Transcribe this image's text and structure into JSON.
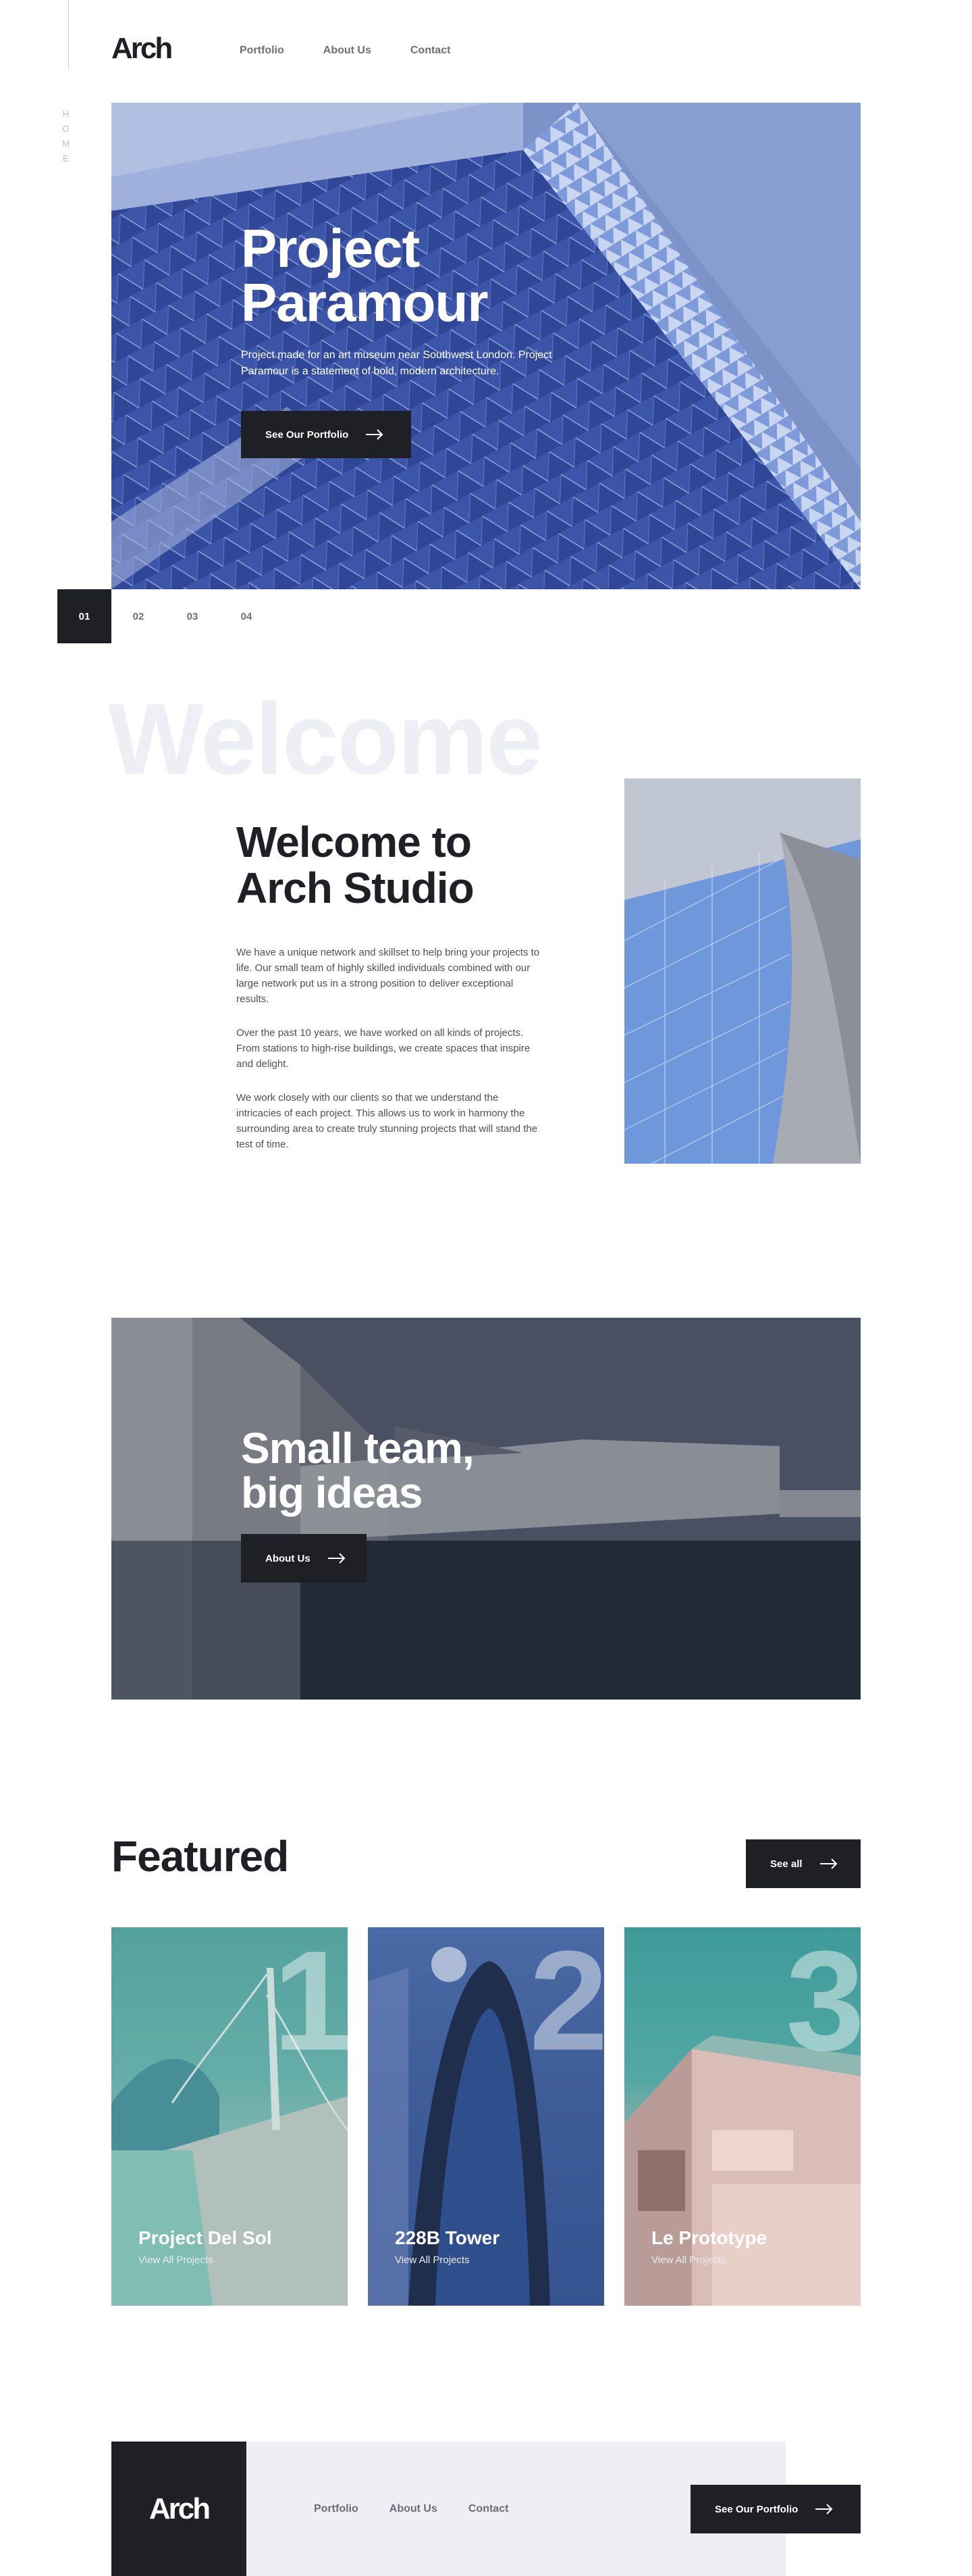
{
  "rail": {
    "label": [
      "H",
      "O",
      "M",
      "E"
    ]
  },
  "header": {
    "logo": "Arch",
    "nav": [
      "Portfolio",
      "About Us",
      "Contact"
    ]
  },
  "hero": {
    "title_line1": "Project",
    "title_line2": "Paramour",
    "description": "Project made for an art museum near Southwest London. Project Paramour is a statement of bold, modern architecture.",
    "button": "See Our Portfolio",
    "slides": [
      "01",
      "02",
      "03",
      "04"
    ],
    "active_slide": "01"
  },
  "welcome": {
    "ghost": "Welcome",
    "title": "Welcome to Arch Studio",
    "paragraphs": [
      "We have a unique network and skillset to help bring your projects to life. Our small team of highly skilled individuals combined with our large network put us in a strong position to deliver exceptional results.",
      "Over the past 10 years, we have worked on all kinds of projects. From stations to high-rise buildings, we create spaces that inspire and delight.",
      "We work closely with our clients so that we understand the intricacies of each project. This allows us to work in harmony the surrounding area to create truly stunning projects that will stand the test of time."
    ]
  },
  "team": {
    "title_line1": "Small team,",
    "title_line2": "big ideas",
    "button": "About Us"
  },
  "featured": {
    "title": "Featured",
    "see_all": "See all",
    "cards": [
      {
        "number": "1",
        "title": "Project Del Sol",
        "subtitle": "View All Projects"
      },
      {
        "number": "2",
        "title": "228B Tower",
        "subtitle": "View All Projects"
      },
      {
        "number": "3",
        "title": "Le Prototype",
        "subtitle": "View All Projects"
      }
    ]
  },
  "footer": {
    "logo": "Arch",
    "nav": [
      "Portfolio",
      "About Us",
      "Contact"
    ],
    "button": "See Our Portfolio"
  },
  "colors": {
    "dark": "#1f1f26",
    "muted": "#6b6e78",
    "light_bg": "#eeeff4",
    "white": "#ffffff"
  }
}
